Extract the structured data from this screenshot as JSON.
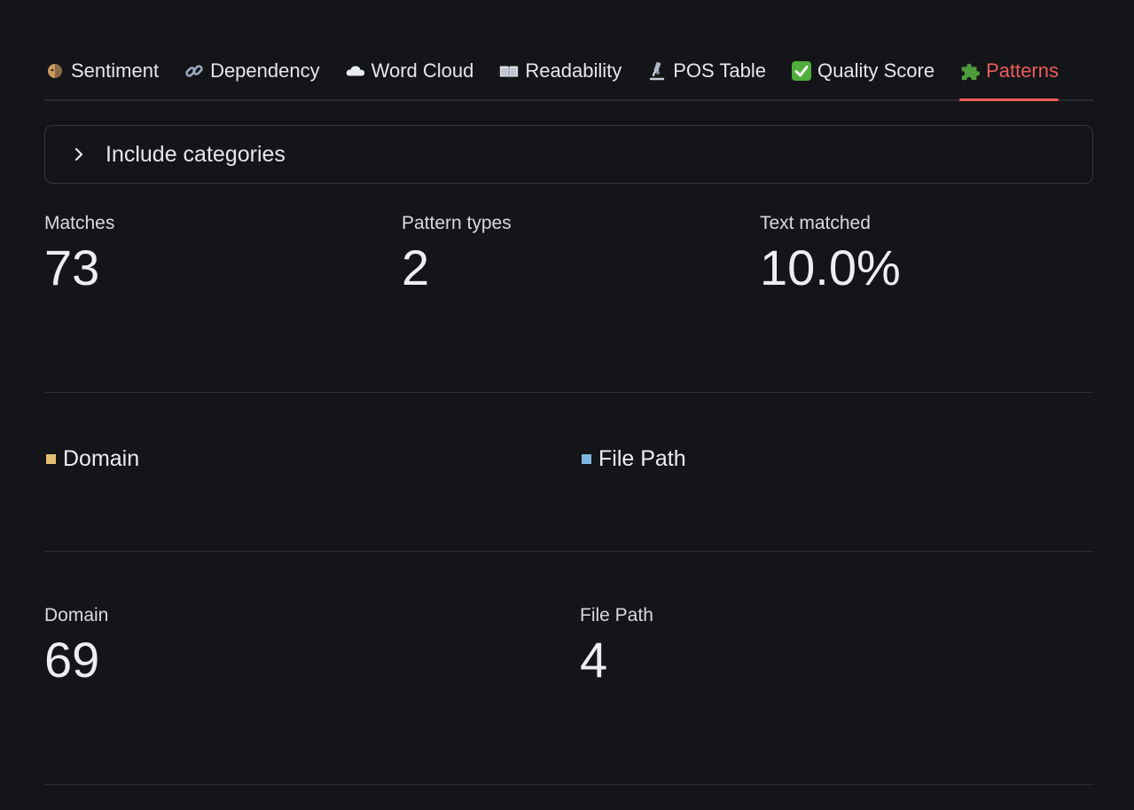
{
  "tabs": [
    {
      "label": "Sentiment",
      "icon": "sentiment-icon",
      "active": false
    },
    {
      "label": "Dependency",
      "icon": "link-icon",
      "active": false
    },
    {
      "label": "Word Cloud",
      "icon": "cloud-icon",
      "active": false
    },
    {
      "label": "Readability",
      "icon": "book-icon",
      "active": false
    },
    {
      "label": "POS Table",
      "icon": "microscope-icon",
      "active": false
    },
    {
      "label": "Quality Score",
      "icon": "check-icon",
      "active": false
    },
    {
      "label": "Patterns",
      "icon": "puzzle-icon",
      "active": true
    }
  ],
  "accent_color": "#ec5c5c",
  "expander": {
    "label": "Include categories",
    "icon": "chevron-right-icon",
    "expanded": false
  },
  "summary": {
    "matches_label": "Matches",
    "matches_value": "73",
    "pattern_types_label": "Pattern types",
    "pattern_types_value": "2",
    "text_matched_label": "Text matched",
    "text_matched_value": "10.0%"
  },
  "legend": [
    {
      "label": "Domain",
      "color": "#e3bd72"
    },
    {
      "label": "File Path",
      "color": "#7fb6dd"
    }
  ],
  "category_counts": [
    {
      "label": "Domain",
      "value": "69"
    },
    {
      "label": "File Path",
      "value": "4"
    }
  ]
}
